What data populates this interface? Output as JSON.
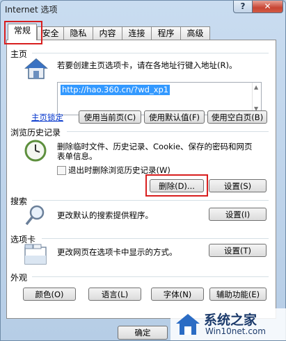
{
  "window": {
    "title": "Internet 选项",
    "help": "?",
    "close": "✕"
  },
  "tabs": [
    "常规",
    "安全",
    "隐私",
    "内容",
    "连接",
    "程序",
    "高级"
  ],
  "home": {
    "title": "主页",
    "desc": "若要创建主页选项卡，请在各地址行键入地址(R)。",
    "url": "http://hao.360.cn/?wd_xp1",
    "link": "主页锁定",
    "btn_current": "使用当前页(C)",
    "btn_default": "使用默认值(F)",
    "btn_blank": "使用空白页(B)"
  },
  "history": {
    "title": "浏览历史记录",
    "desc_line1": "删除临时文件、历史记录、Cookie、保存的密码和网页",
    "desc_line2": "表单信息。",
    "checkbox": "退出时删除浏览历史记录(W)",
    "btn_delete": "删除(D)...",
    "btn_settings": "设置(S)"
  },
  "search": {
    "title": "搜索",
    "desc": "更改默认的搜索提供程序。",
    "btn": "设置(I)"
  },
  "tabsec": {
    "title": "选项卡",
    "desc": "更改网页在选项卡中显示的方式。",
    "btn": "设置(T)"
  },
  "appearance": {
    "title": "外观",
    "btn_colors": "颜色(O)",
    "btn_lang": "语言(L)",
    "btn_font": "字体(N)",
    "btn_access": "辅助功能(E)"
  },
  "footer": {
    "ok": "确定"
  },
  "watermark": {
    "line1": "系统之家",
    "line2": "Win10net.com"
  }
}
